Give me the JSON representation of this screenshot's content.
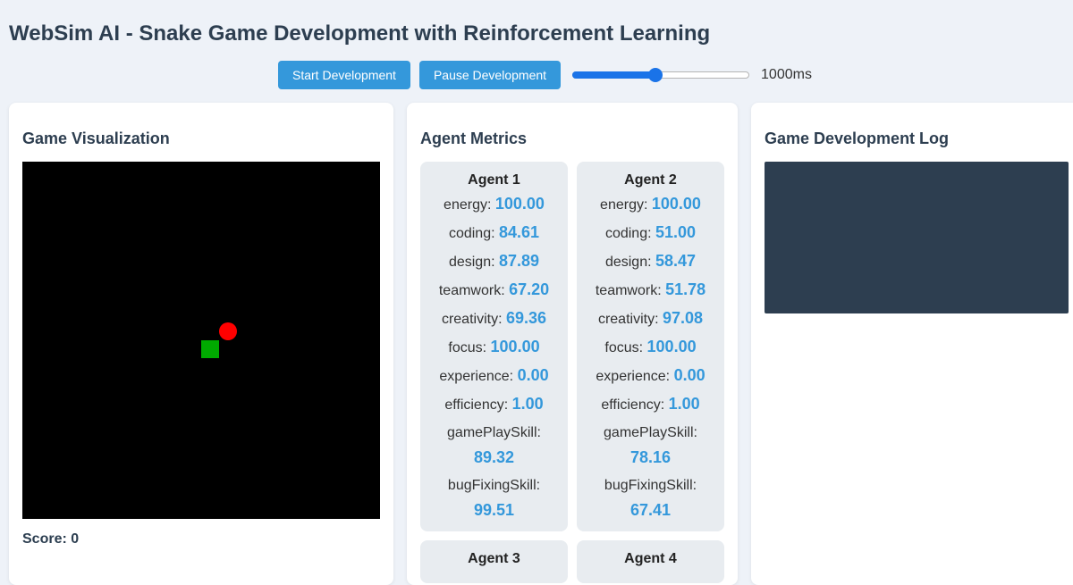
{
  "header": {
    "title": "WebSim AI - Snake Game Development with Reinforcement Learning"
  },
  "controls": {
    "start_label": "Start Development",
    "pause_label": "Pause Development",
    "speed_value": "1000ms",
    "speed_slider_fraction": 0.47,
    "accent_color": "#1a73e8",
    "button_color": "#3498db"
  },
  "game": {
    "title": "Game Visualization",
    "score_text": "Score: 0",
    "snake_color": "#00aa00",
    "food_color": "#ff0000"
  },
  "metrics": {
    "title": "Agent Metrics",
    "agents": [
      {
        "name": "Agent 1",
        "metrics": [
          {
            "label": "energy:",
            "value": "100.00"
          },
          {
            "label": "coding:",
            "value": "84.61"
          },
          {
            "label": "design:",
            "value": "87.89"
          },
          {
            "label": "teamwork:",
            "value": "67.20"
          },
          {
            "label": "creativity:",
            "value": "69.36"
          },
          {
            "label": "focus:",
            "value": "100.00"
          },
          {
            "label": "experience:",
            "value": "0.00"
          },
          {
            "label": "efficiency:",
            "value": "1.00"
          },
          {
            "label": "gamePlaySkill:",
            "value": "89.32"
          },
          {
            "label": "bugFixingSkill:",
            "value": "99.51"
          }
        ]
      },
      {
        "name": "Agent 2",
        "metrics": [
          {
            "label": "energy:",
            "value": "100.00"
          },
          {
            "label": "coding:",
            "value": "51.00"
          },
          {
            "label": "design:",
            "value": "58.47"
          },
          {
            "label": "teamwork:",
            "value": "51.78"
          },
          {
            "label": "creativity:",
            "value": "97.08"
          },
          {
            "label": "focus:",
            "value": "100.00"
          },
          {
            "label": "experience:",
            "value": "0.00"
          },
          {
            "label": "efficiency:",
            "value": "1.00"
          },
          {
            "label": "gamePlaySkill:",
            "value": "78.16"
          },
          {
            "label": "bugFixingSkill:",
            "value": "67.41"
          }
        ]
      },
      {
        "name": "Agent 3",
        "metrics": []
      },
      {
        "name": "Agent 4",
        "metrics": []
      }
    ]
  },
  "log": {
    "title": "Game Development Log"
  }
}
